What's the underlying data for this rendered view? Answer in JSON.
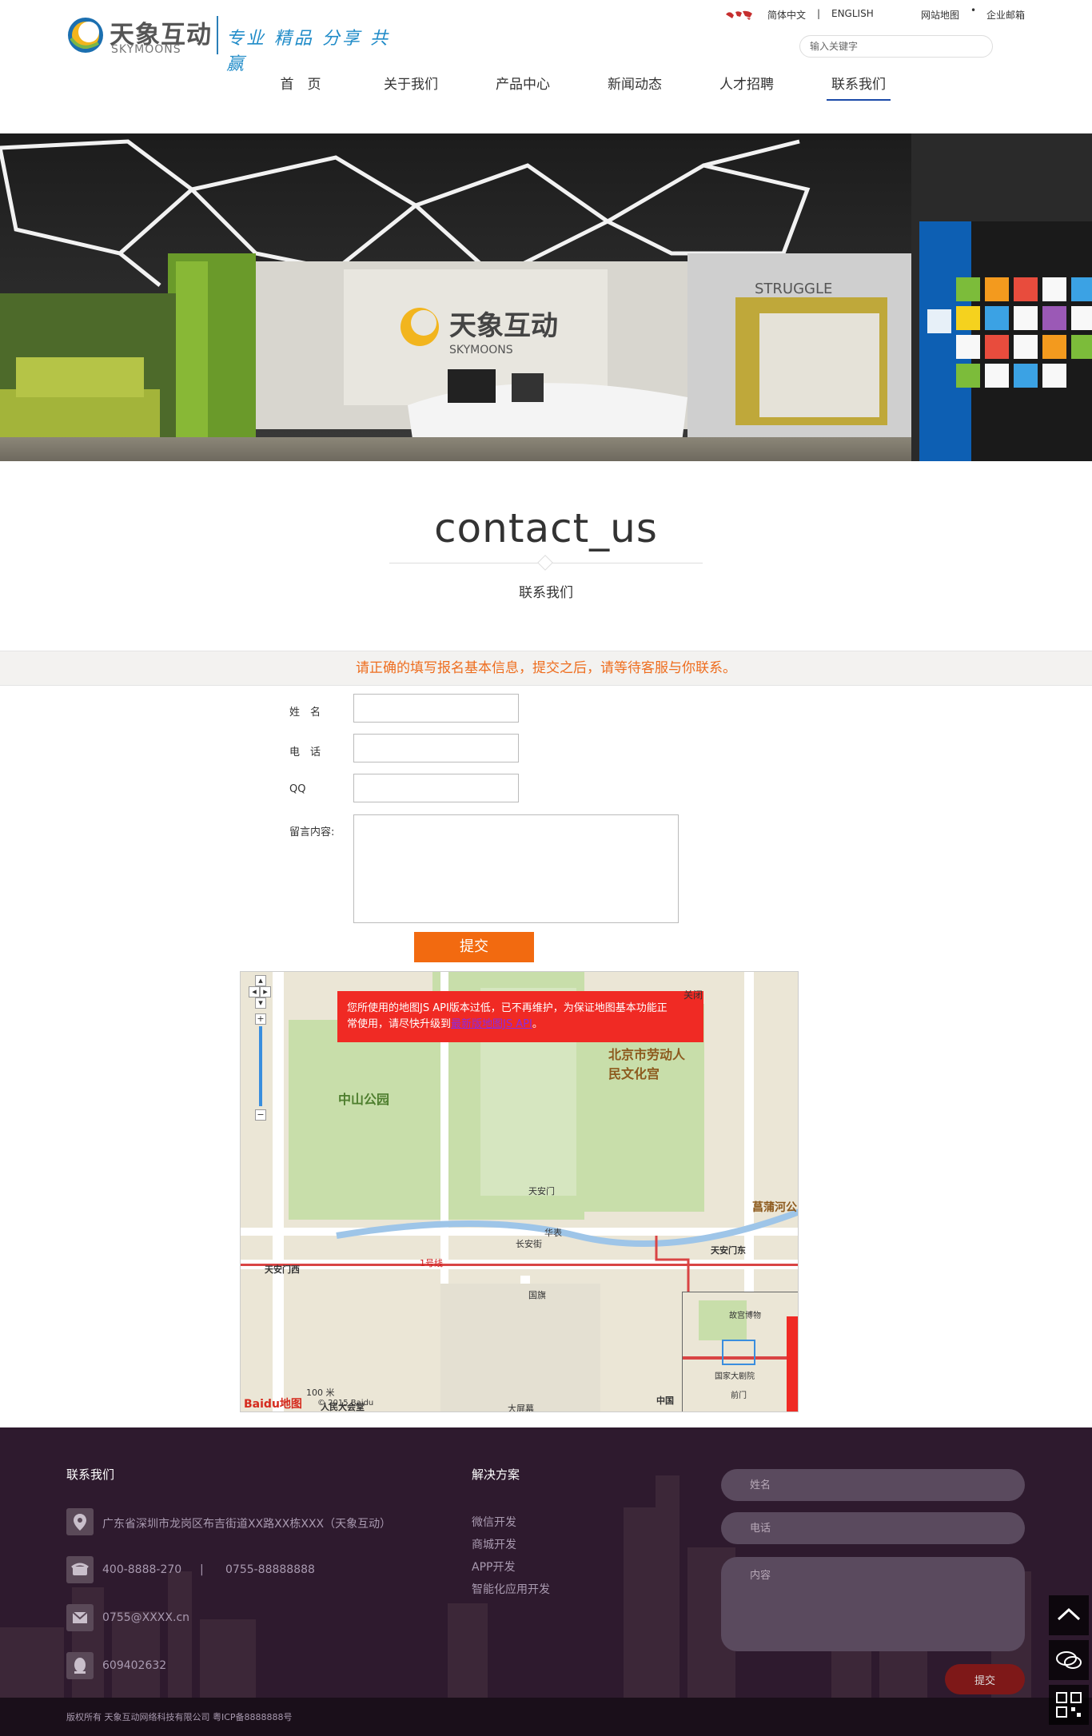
{
  "header": {
    "logo_cn": "天象互动",
    "logo_en": "SKYMOONS",
    "slogan": "专业 精品 分享 共赢",
    "lang_cn": "简体中文",
    "lang_sep": "|",
    "lang_en": "ENGLISH",
    "sitemap": "网站地图",
    "email": "企业邮箱",
    "search_placeholder": "输入关键字"
  },
  "nav": [
    {
      "label": "首　页"
    },
    {
      "label": "关于我们"
    },
    {
      "label": "产品中心"
    },
    {
      "label": "新闻动态"
    },
    {
      "label": "人才招聘"
    },
    {
      "label": "联系我们"
    }
  ],
  "banner": {
    "struggle_text": "STRUGGLE",
    "wall_logo_cn": "天象互动",
    "wall_logo_en": "SKYMOONS"
  },
  "page_title": {
    "en": "contact_us",
    "cn": "联系我们"
  },
  "notice": "请正确的填写报名基本信息，提交之后，请等待客服与你联系。",
  "form": {
    "name_label": "姓　名",
    "phone_label": "电　话",
    "qq_label": "QQ",
    "message_label": "留言内容:",
    "submit_label": "提交"
  },
  "map": {
    "warning_line1": "您所使用的地图JS API版本过低，已不再维护，为保证地图基本功能正",
    "warning_line2_prefix": "常使用，请尽快升级到",
    "warning_link": "最新版地图JS API",
    "warning_suffix": "。",
    "close": "关闭",
    "labels": {
      "zhongshan": "中山公园",
      "laodong": "北京市劳动人民文化宫",
      "tiananmen": "天安门",
      "tiananmen_west": "天安门西",
      "tiananmen_east": "天安门东",
      "changan": "长安街",
      "huabiao": "华表",
      "guoqi": "国旗",
      "line1": "1号线",
      "gugong": "故宫博物",
      "guojia": "国家大剧院",
      "qianmen": "前门",
      "dapingmu": "大屏幕",
      "zhongguo": "中国",
      "chuanhe": "菖蒲河公",
      "renmin": "人民大会堂",
      "scale": "100 米",
      "copyright": "© 2015 Baidu",
      "baidu": "Baidu地图"
    }
  },
  "footer": {
    "contact_title": "联系我们",
    "address": "广东省深圳市龙岗区布吉街道XX路XX栋XXX（天象互动）",
    "phone1": "400-8888-270",
    "phone_sep": "|",
    "phone2": "0755-88888888",
    "email": "0755@XXXX.cn",
    "qq": "609402632",
    "solutions_title": "解决方案",
    "solutions": [
      "微信开发",
      "商城开发",
      "APP开发",
      "智能化应用开发"
    ],
    "name_placeholder": "姓名",
    "phone_placeholder": "电话",
    "content_placeholder": "内容",
    "submit_label": "提交",
    "copyright": "版权所有 天象互动网络科技有限公司 粤ICP备8888888号"
  }
}
